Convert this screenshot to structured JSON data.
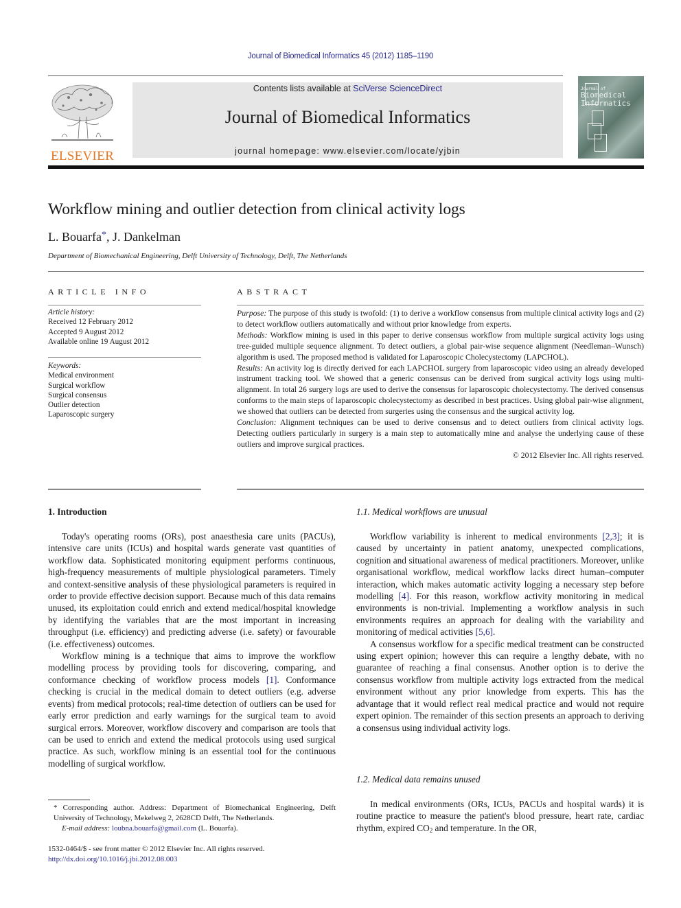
{
  "header": {
    "citation": "Journal of Biomedical Informatics 45 (2012) 1185–1190",
    "contents_prefix": "Contents lists available at ",
    "contents_link": "SciVerse ScienceDirect",
    "journal_title": "Journal of Biomedical Informatics",
    "homepage": "journal homepage: www.elsevier.com/locate/yjbin",
    "publisher_word": "ELSEVIER",
    "cover": {
      "line_small": "Journal of",
      "line1": "Biomedical",
      "line2": "Informatics"
    },
    "colors": {
      "link": "#2a2a8c",
      "publisher": "#e87722",
      "banner_bg": "#e6e6e6"
    }
  },
  "article": {
    "title": "Workflow mining and outlier detection from clinical activity logs",
    "authors": {
      "first": "L. Bouarfa",
      "star": "*",
      "rest": ", J. Dankelman"
    },
    "affiliation": "Department of Biomechanical Engineering, Delft University of Technology, Delft, The Netherlands"
  },
  "article_info": {
    "heading": "ARTICLE INFO",
    "history_label": "Article history:",
    "history": [
      "Received 12 February 2012",
      "Accepted 9 August 2012",
      "Available online 19 August 2012"
    ],
    "keywords_label": "Keywords:",
    "keywords": [
      "Medical environment",
      "Surgical workflow",
      "Surgical consensus",
      "Outlier detection",
      "Laparoscopic surgery"
    ]
  },
  "abstract": {
    "heading": "ABSTRACT",
    "purpose_label": "Purpose:",
    "purpose": " The purpose of this study is twofold: (1) to derive a workflow consensus from multiple clinical activity logs and (2) to detect workflow outliers automatically and without prior knowledge from experts.",
    "methods_label": "Methods:",
    "methods": " Workflow mining is used in this paper to derive consensus workflow from multiple surgical activity logs using tree-guided multiple sequence alignment. To detect outliers, a global pair-wise sequence alignment (Needleman–Wunsch) algorithm is used. The proposed method is validated for Laparoscopic Cholecystectomy (LAPCHOL).",
    "results_label": "Results:",
    "results": " An activity log is directly derived for each LAPCHOL surgery from laparoscopic video using an already developed instrument tracking tool. We showed that a generic consensus can be derived from surgical activity logs using multi-alignment. In total 26 surgery logs are used to derive the consensus for laparoscopic cholecystectomy. The derived consensus conforms to the main steps of laparoscopic cholecystectomy as described in best practices. Using global pair-wise alignment, we showed that outliers can be detected from surgeries using the consensus and the surgical activity log.",
    "conclusion_label": "Conclusion:",
    "conclusion": " Alignment techniques can be used to derive consensus and to detect outliers from clinical activity logs. Detecting outliers particularly in surgery is a main step to automatically mine and analyse the underlying cause of these outliers and improve surgical practices.",
    "copyright": "© 2012 Elsevier Inc. All rights reserved."
  },
  "body": {
    "intro_heading": "1. Introduction",
    "intro_p1": "Today's operating rooms (ORs), post anaesthesia care units (PACUs), intensive care units (ICUs) and hospital wards generate vast quantities of workflow data. Sophisticated monitoring equipment performs continuous, high-frequency measurements of multiple physiological parameters. Timely and context-sensitive analysis of these physiological parameters is required in order to provide effective decision support. Because much of this data remains unused, its exploitation could enrich and extend medical/hospital knowledge by identifying the variables that are the most important in increasing throughput (i.e. efficiency) and predicting adverse (i.e. safety) or favourable (i.e. effectiveness) outcomes.",
    "intro_p2_a": "Workflow mining is a technique that aims to improve the workflow modelling process by providing tools for discovering, comparing, and conformance checking of workflow process models ",
    "intro_p2_ref": "[1]",
    "intro_p2_b": ". Conformance checking is crucial in the medical domain to detect outliers (e.g. adverse events) from medical protocols; real-time detection of outliers can be used for early error prediction and early warnings for the surgical team to avoid surgical errors. Moreover, workflow discovery and comparison are tools that can be used to enrich and extend the medical protocols using used surgical practice. As such, workflow mining is an essential tool for the continuous modelling of surgical workflow.",
    "s11_heading": "1.1. Medical workflows are unusual",
    "s11_p1_a": "Workflow variability is inherent to medical environments ",
    "s11_p1_ref1": "[2,3]",
    "s11_p1_b": "; it is caused by uncertainty in patient anatomy, unexpected complications, cognition and situational awareness of medical practitioners. Moreover, unlike organisational workflow, medical workflow lacks direct human–computer interaction, which makes automatic activity logging a necessary step before modelling ",
    "s11_p1_ref2": "[4]",
    "s11_p1_c": ". For this reason, workflow activity monitoring in medical environments is non-trivial. Implementing a workflow analysis in such environments requires an approach for dealing with the variability and monitoring of medical activities ",
    "s11_p1_ref3": "[5,6]",
    "s11_p1_d": ".",
    "s11_p2": "A consensus workflow for a specific medical treatment can be constructed using expert opinion; however this can require a lengthy debate, with no guarantee of reaching a final consensus. Another option is to derive the consensus workflow from multiple activity logs extracted from the medical environment without any prior knowledge from experts. This has the advantage that it would reflect real medical practice and would not require expert opinion. The remainder of this section presents an approach to deriving a consensus using individual activity logs.",
    "s12_heading": "1.2. Medical data remains unused",
    "s12_p1_a": "In medical environments (ORs, ICUs, PACUs and hospital wards) it is routine practice to measure the patient's blood pressure, heart rate, cardiac rhythm, expired CO",
    "s12_p1_sub": "2",
    "s12_p1_b": " and temperature. In the OR,"
  },
  "footnote": {
    "corresponding": "* Corresponding author. Address: Department of Biomechanical Engineering, Delft University of Technology, Mekelweg 2, 2628CD Delft, The Netherlands.",
    "email_label": "E-mail address:",
    "email": "loubna.bouarfa@gmail.com",
    "email_suffix": " (L. Bouarfa).",
    "issn": "1532-0464/$ - see front matter © 2012 Elsevier Inc. All rights reserved.",
    "doi": "http://dx.doi.org/10.1016/j.jbi.2012.08.003"
  }
}
